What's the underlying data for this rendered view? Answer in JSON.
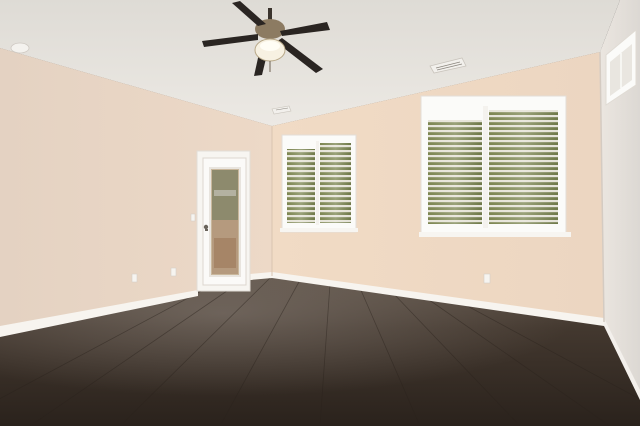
{
  "scene": {
    "subject": "empty-room-interior",
    "colors": {
      "ceiling": "#e9e6e1",
      "wall_left": "#e8d8c9",
      "wall_back": "#efd9c4",
      "wall_right": "#e4e1dd",
      "baseboard": "#f5f2ee",
      "floor_dark": "#2f2720",
      "floor_mid": "#4a3f35",
      "floor_light": "#6a5f55",
      "window_frame": "#fbfbf9",
      "shutter": "#e7e4dc",
      "foliage": "#6f7a4a",
      "fan_blade": "#2a2522",
      "fan_light": "#f7f1e2"
    }
  }
}
